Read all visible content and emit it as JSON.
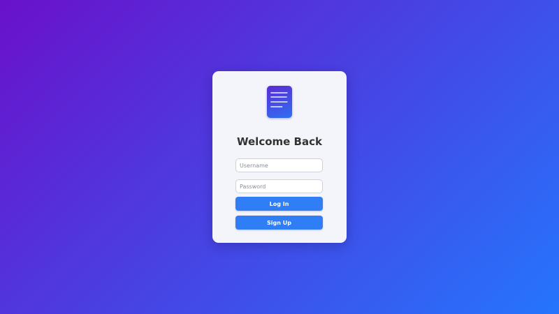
{
  "colors": {
    "background_start": "#6a11cb",
    "background_end": "#2575fc",
    "card": "#f4f5fb",
    "button": "#2f7ef5",
    "title_text": "#333333"
  },
  "logo": {
    "icon": "document-icon"
  },
  "login_card": {
    "title": "Welcome Back",
    "username": {
      "value": "",
      "placeholder": "Username"
    },
    "password": {
      "value": "",
      "placeholder": "Password"
    },
    "login_label": "Log In",
    "signup_label": "Sign Up"
  }
}
